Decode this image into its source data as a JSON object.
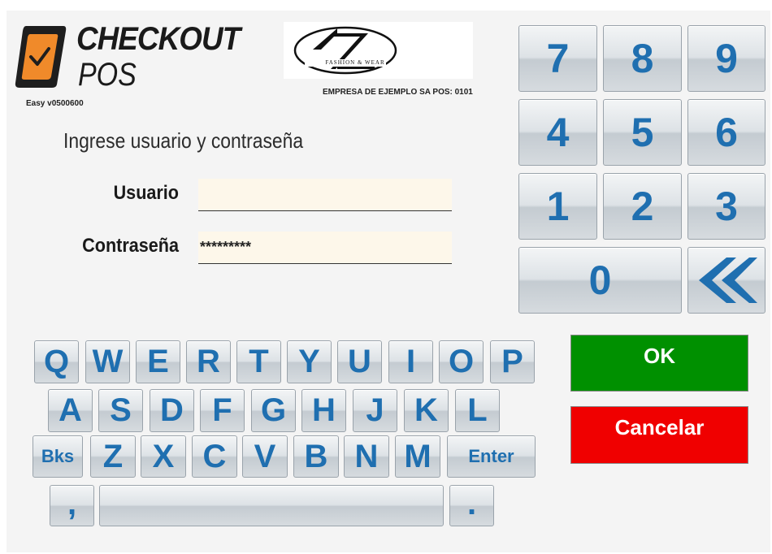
{
  "brand": {
    "name": "CHECKOUT",
    "sub": "POS",
    "version": "Easy v0500600"
  },
  "company": {
    "logo_text": "FASHION & WEAR",
    "label": "EMPRESA DE EJEMPLO SA POS: 0101"
  },
  "login": {
    "prompt": "Ingrese usuario y contraseña",
    "user_label": "Usuario",
    "user_value": "",
    "password_label": "Contraseña",
    "password_value": "*********"
  },
  "numpad": {
    "keys": [
      "7",
      "8",
      "9",
      "4",
      "5",
      "6",
      "1",
      "2",
      "3",
      "0"
    ],
    "backspace_icon": "double-left-arrow-icon"
  },
  "keyboard": {
    "row1": [
      "Q",
      "W",
      "E",
      "R",
      "T",
      "Y",
      "U",
      "I",
      "O",
      "P"
    ],
    "row2": [
      "A",
      "S",
      "D",
      "F",
      "G",
      "H",
      "J",
      "K",
      "L"
    ],
    "row3": [
      "Z",
      "X",
      "C",
      "V",
      "B",
      "N",
      "M"
    ],
    "bks": "Bks",
    "enter": "Enter",
    "comma": ",",
    "period": "."
  },
  "actions": {
    "ok": "OK",
    "cancel": "Cancelar"
  },
  "colors": {
    "ok": "#009000",
    "cancel": "#f00000",
    "key_text": "#1f6fb0",
    "brand_orange": "#f08a2a"
  }
}
